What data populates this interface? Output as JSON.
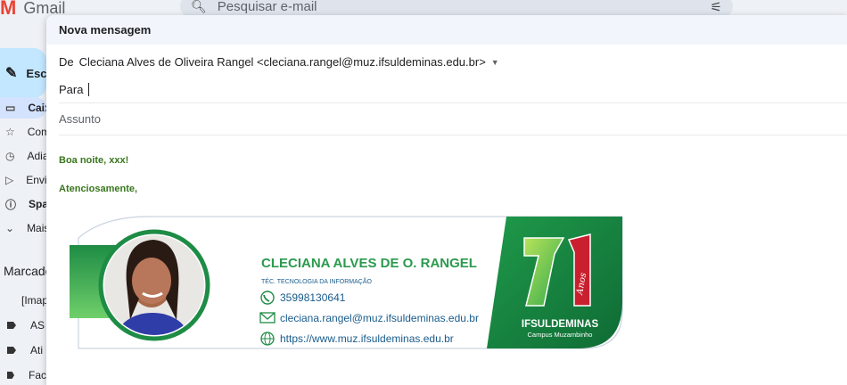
{
  "gmail": {
    "logo_text": "Gmail",
    "search_placeholder": "Pesquisar e-mail",
    "compose_label": "Escrever",
    "nav": [
      {
        "label": "Caixa de entrada",
        "icon": "inbox-icon",
        "glyph": "▭",
        "active": true
      },
      {
        "label": "Com estrela",
        "icon": "star-icon",
        "glyph": "☆",
        "active": false
      },
      {
        "label": "Adiados",
        "icon": "clock-icon",
        "glyph": "◷",
        "active": false
      },
      {
        "label": "Enviados",
        "icon": "send-icon",
        "glyph": "▷",
        "active": false
      },
      {
        "label": "Spam",
        "icon": "spam-icon",
        "glyph": "ⓘ",
        "active": false
      },
      {
        "label": "Mais",
        "icon": "chevron-down-icon",
        "glyph": "⌄",
        "active": false
      }
    ],
    "labels_title": "Marcadores",
    "labels": [
      "[Imap]",
      "AS",
      "Ati",
      "Fac"
    ]
  },
  "compose": {
    "title": "Nova mensagem",
    "from_label": "De",
    "from_value": "Cleciana Alves de Oliveira Rangel <cleciana.rangel@muz.ifsuldeminas.edu.br>",
    "to_label": "Para",
    "subject_placeholder": "Assunto",
    "greeting": "Boa noite, xxx!",
    "closing": "Atenciosamente,"
  },
  "signature": {
    "name": "CLECIANA ALVES DE O. RANGEL",
    "role": "TÉC. TECNOLOGIA DA INFORMAÇÃO",
    "phone": "35998130641",
    "email": "cleciana.rangel@muz.ifsuldeminas.edu.br",
    "website": "https://www.muz.ifsuldeminas.edu.br",
    "badge_number": "71",
    "badge_word": "Anos",
    "institution": "IFSULDEMINAS",
    "campus": "Campus Muzambinho",
    "colors": {
      "green": "#1e8c45",
      "dark_green": "#0f6b35",
      "red": "#c8202f",
      "name_green": "#2b9a4e"
    }
  }
}
